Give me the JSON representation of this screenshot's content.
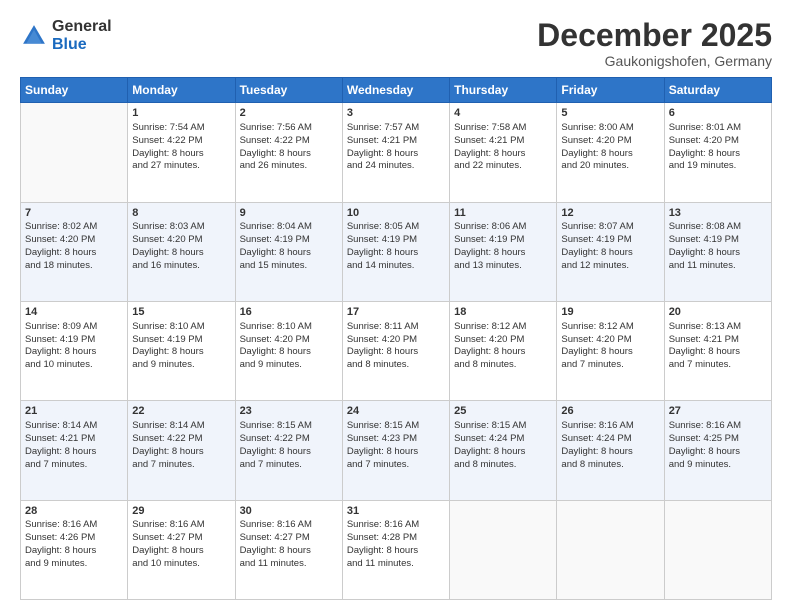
{
  "logo": {
    "general": "General",
    "blue": "Blue"
  },
  "header": {
    "month": "December 2025",
    "location": "Gaukonigshofen, Germany"
  },
  "weekdays": [
    "Sunday",
    "Monday",
    "Tuesday",
    "Wednesday",
    "Thursday",
    "Friday",
    "Saturday"
  ],
  "weeks": [
    [
      {
        "day": "",
        "info": ""
      },
      {
        "day": "1",
        "info": "Sunrise: 7:54 AM\nSunset: 4:22 PM\nDaylight: 8 hours\nand 27 minutes."
      },
      {
        "day": "2",
        "info": "Sunrise: 7:56 AM\nSunset: 4:22 PM\nDaylight: 8 hours\nand 26 minutes."
      },
      {
        "day": "3",
        "info": "Sunrise: 7:57 AM\nSunset: 4:21 PM\nDaylight: 8 hours\nand 24 minutes."
      },
      {
        "day": "4",
        "info": "Sunrise: 7:58 AM\nSunset: 4:21 PM\nDaylight: 8 hours\nand 22 minutes."
      },
      {
        "day": "5",
        "info": "Sunrise: 8:00 AM\nSunset: 4:20 PM\nDaylight: 8 hours\nand 20 minutes."
      },
      {
        "day": "6",
        "info": "Sunrise: 8:01 AM\nSunset: 4:20 PM\nDaylight: 8 hours\nand 19 minutes."
      }
    ],
    [
      {
        "day": "7",
        "info": "Sunrise: 8:02 AM\nSunset: 4:20 PM\nDaylight: 8 hours\nand 18 minutes."
      },
      {
        "day": "8",
        "info": "Sunrise: 8:03 AM\nSunset: 4:20 PM\nDaylight: 8 hours\nand 16 minutes."
      },
      {
        "day": "9",
        "info": "Sunrise: 8:04 AM\nSunset: 4:19 PM\nDaylight: 8 hours\nand 15 minutes."
      },
      {
        "day": "10",
        "info": "Sunrise: 8:05 AM\nSunset: 4:19 PM\nDaylight: 8 hours\nand 14 minutes."
      },
      {
        "day": "11",
        "info": "Sunrise: 8:06 AM\nSunset: 4:19 PM\nDaylight: 8 hours\nand 13 minutes."
      },
      {
        "day": "12",
        "info": "Sunrise: 8:07 AM\nSunset: 4:19 PM\nDaylight: 8 hours\nand 12 minutes."
      },
      {
        "day": "13",
        "info": "Sunrise: 8:08 AM\nSunset: 4:19 PM\nDaylight: 8 hours\nand 11 minutes."
      }
    ],
    [
      {
        "day": "14",
        "info": "Sunrise: 8:09 AM\nSunset: 4:19 PM\nDaylight: 8 hours\nand 10 minutes."
      },
      {
        "day": "15",
        "info": "Sunrise: 8:10 AM\nSunset: 4:19 PM\nDaylight: 8 hours\nand 9 minutes."
      },
      {
        "day": "16",
        "info": "Sunrise: 8:10 AM\nSunset: 4:20 PM\nDaylight: 8 hours\nand 9 minutes."
      },
      {
        "day": "17",
        "info": "Sunrise: 8:11 AM\nSunset: 4:20 PM\nDaylight: 8 hours\nand 8 minutes."
      },
      {
        "day": "18",
        "info": "Sunrise: 8:12 AM\nSunset: 4:20 PM\nDaylight: 8 hours\nand 8 minutes."
      },
      {
        "day": "19",
        "info": "Sunrise: 8:12 AM\nSunset: 4:20 PM\nDaylight: 8 hours\nand 7 minutes."
      },
      {
        "day": "20",
        "info": "Sunrise: 8:13 AM\nSunset: 4:21 PM\nDaylight: 8 hours\nand 7 minutes."
      }
    ],
    [
      {
        "day": "21",
        "info": "Sunrise: 8:14 AM\nSunset: 4:21 PM\nDaylight: 8 hours\nand 7 minutes."
      },
      {
        "day": "22",
        "info": "Sunrise: 8:14 AM\nSunset: 4:22 PM\nDaylight: 8 hours\nand 7 minutes."
      },
      {
        "day": "23",
        "info": "Sunrise: 8:15 AM\nSunset: 4:22 PM\nDaylight: 8 hours\nand 7 minutes."
      },
      {
        "day": "24",
        "info": "Sunrise: 8:15 AM\nSunset: 4:23 PM\nDaylight: 8 hours\nand 7 minutes."
      },
      {
        "day": "25",
        "info": "Sunrise: 8:15 AM\nSunset: 4:24 PM\nDaylight: 8 hours\nand 8 minutes."
      },
      {
        "day": "26",
        "info": "Sunrise: 8:16 AM\nSunset: 4:24 PM\nDaylight: 8 hours\nand 8 minutes."
      },
      {
        "day": "27",
        "info": "Sunrise: 8:16 AM\nSunset: 4:25 PM\nDaylight: 8 hours\nand 9 minutes."
      }
    ],
    [
      {
        "day": "28",
        "info": "Sunrise: 8:16 AM\nSunset: 4:26 PM\nDaylight: 8 hours\nand 9 minutes."
      },
      {
        "day": "29",
        "info": "Sunrise: 8:16 AM\nSunset: 4:27 PM\nDaylight: 8 hours\nand 10 minutes."
      },
      {
        "day": "30",
        "info": "Sunrise: 8:16 AM\nSunset: 4:27 PM\nDaylight: 8 hours\nand 11 minutes."
      },
      {
        "day": "31",
        "info": "Sunrise: 8:16 AM\nSunset: 4:28 PM\nDaylight: 8 hours\nand 11 minutes."
      },
      {
        "day": "",
        "info": ""
      },
      {
        "day": "",
        "info": ""
      },
      {
        "day": "",
        "info": ""
      }
    ]
  ]
}
